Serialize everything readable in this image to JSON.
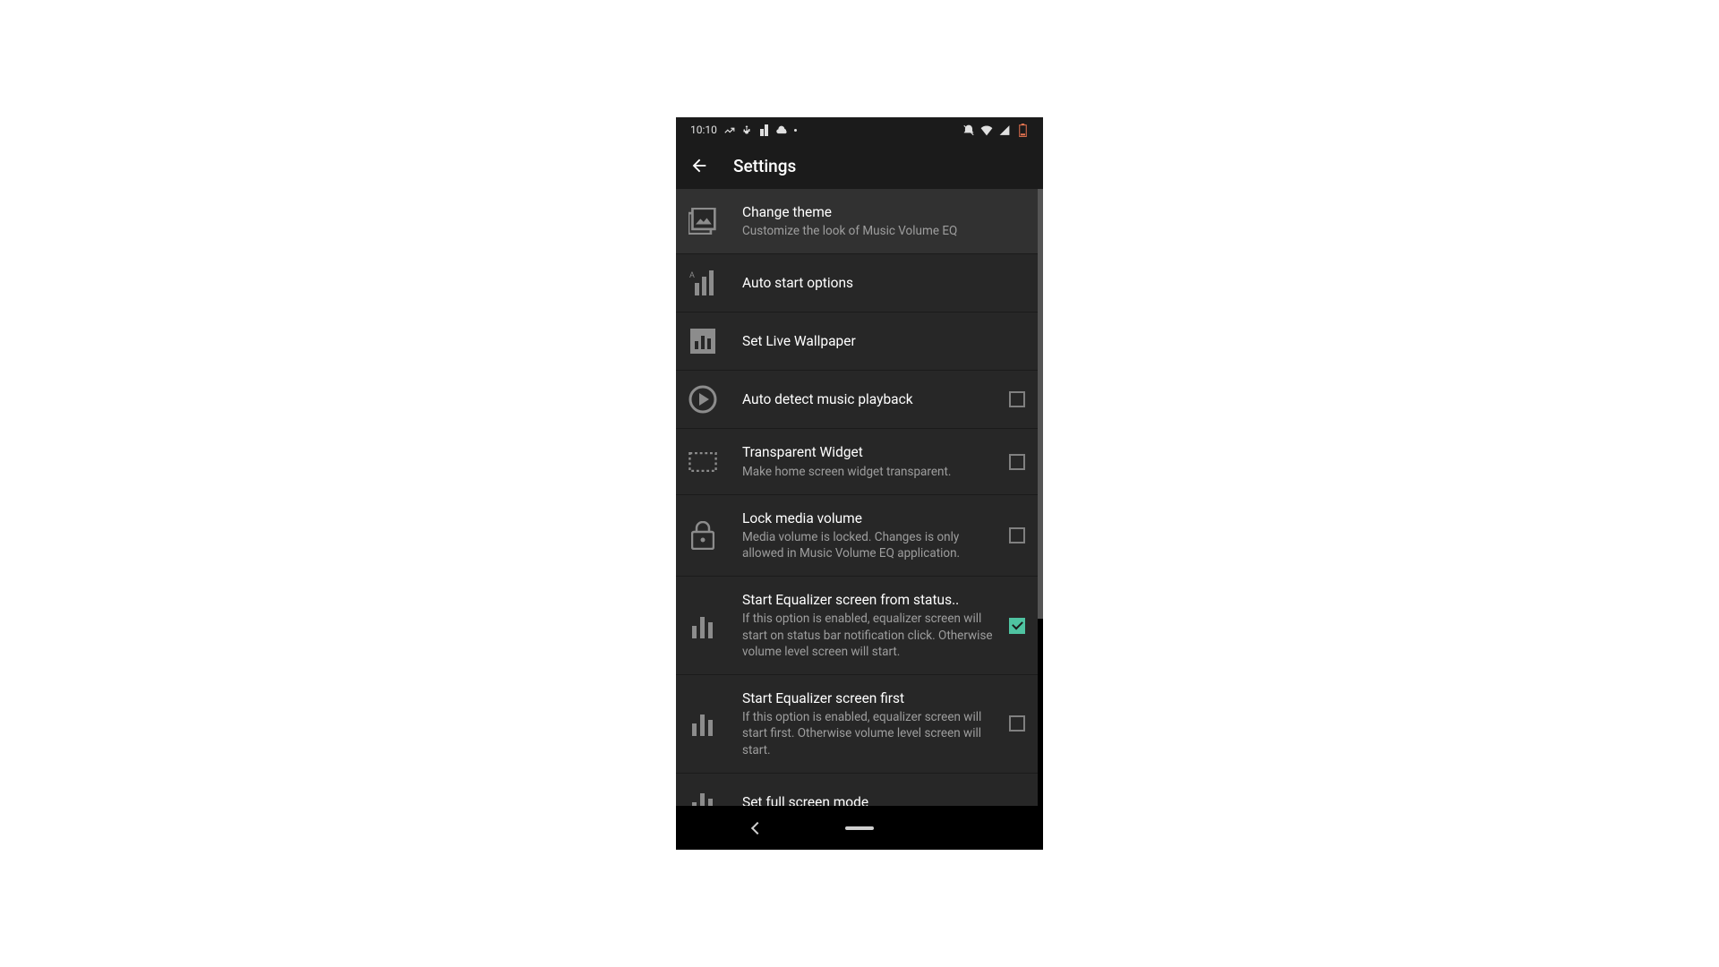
{
  "status_bar": {
    "time": "10:10"
  },
  "app_bar": {
    "title": "Settings"
  },
  "settings": [
    {
      "icon": "image",
      "title": "Change theme",
      "subtitle": "Customize the look of Music Volume EQ",
      "checkbox": null
    },
    {
      "icon": "autostart",
      "title": "Auto start options",
      "subtitle": null,
      "checkbox": null
    },
    {
      "icon": "bars-box",
      "title": "Set Live Wallpaper",
      "subtitle": null,
      "checkbox": null
    },
    {
      "icon": "play-circle",
      "title": "Auto detect music playback",
      "subtitle": null,
      "checkbox": false
    },
    {
      "icon": "dashed-rect",
      "title": "Transparent Widget",
      "subtitle": "Make home screen widget transparent.",
      "checkbox": false
    },
    {
      "icon": "lock",
      "title": "Lock media volume",
      "subtitle": "Media volume is locked. Changes is only allowed in Music Volume EQ application.",
      "checkbox": false
    },
    {
      "icon": "bars",
      "title": "Start Equalizer screen from status..",
      "subtitle": "If this option is enabled, equalizer screen will start on status bar notification click. Otherwise volume level screen will start.",
      "checkbox": true,
      "ellipsis": true
    },
    {
      "icon": "bars",
      "title": "Start Equalizer screen first",
      "subtitle": "If this option is enabled, equalizer screen will start first. Otherwise volume level screen will start.",
      "checkbox": false
    },
    {
      "icon": "bars",
      "title": "Set full screen mode",
      "subtitle": null,
      "checkbox": null
    }
  ]
}
